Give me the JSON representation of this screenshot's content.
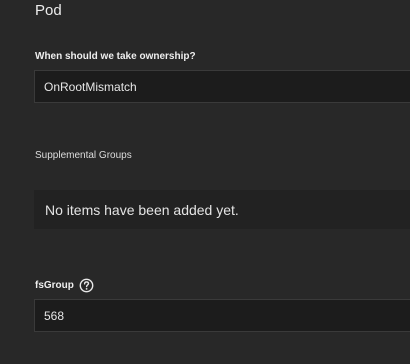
{
  "section": {
    "title": "Pod"
  },
  "ownership": {
    "label": "When should we take ownership?",
    "value": "OnRootMismatch"
  },
  "supplemental_groups": {
    "label": "Supplemental Groups",
    "empty_text": "No items have been added yet."
  },
  "fs_group": {
    "label": "fsGroup",
    "help_icon": "help-circle-icon",
    "value": "568"
  }
}
